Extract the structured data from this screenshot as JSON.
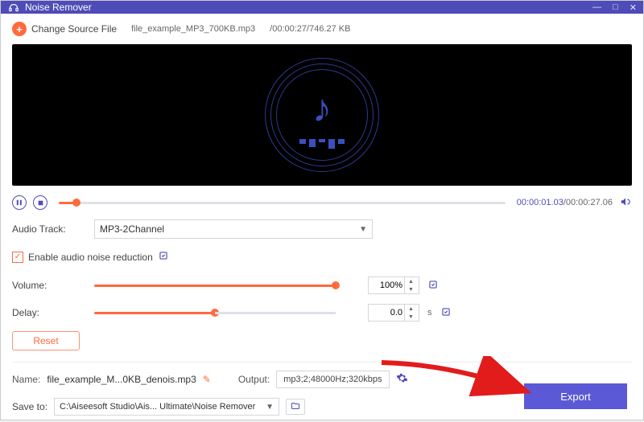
{
  "window": {
    "title": "Noise Remover"
  },
  "toolbar": {
    "change_label": "Change Source File",
    "filename": "file_example_MP3_700KB.mp3",
    "info": "/00:00:27/746.27 KB"
  },
  "playback": {
    "current": "00:00:01.03",
    "total": "/00:00:27.06"
  },
  "audioTrack": {
    "label": "Audio Track:",
    "value": "MP3-2Channel"
  },
  "noise": {
    "label": "Enable audio noise reduction"
  },
  "volume": {
    "label": "Volume:",
    "value": "100%"
  },
  "delay": {
    "label": "Delay:",
    "value": "0.0",
    "unit": "s"
  },
  "reset": "Reset",
  "name": {
    "label": "Name:",
    "value": "file_example_M...0KB_denois.mp3"
  },
  "output": {
    "label": "Output:",
    "value": "mp3;2;48000Hz;320kbps"
  },
  "save": {
    "label": "Save to:",
    "value": "C:\\Aiseesoft Studio\\Ais... Ultimate\\Noise Remover"
  },
  "export": "Export"
}
